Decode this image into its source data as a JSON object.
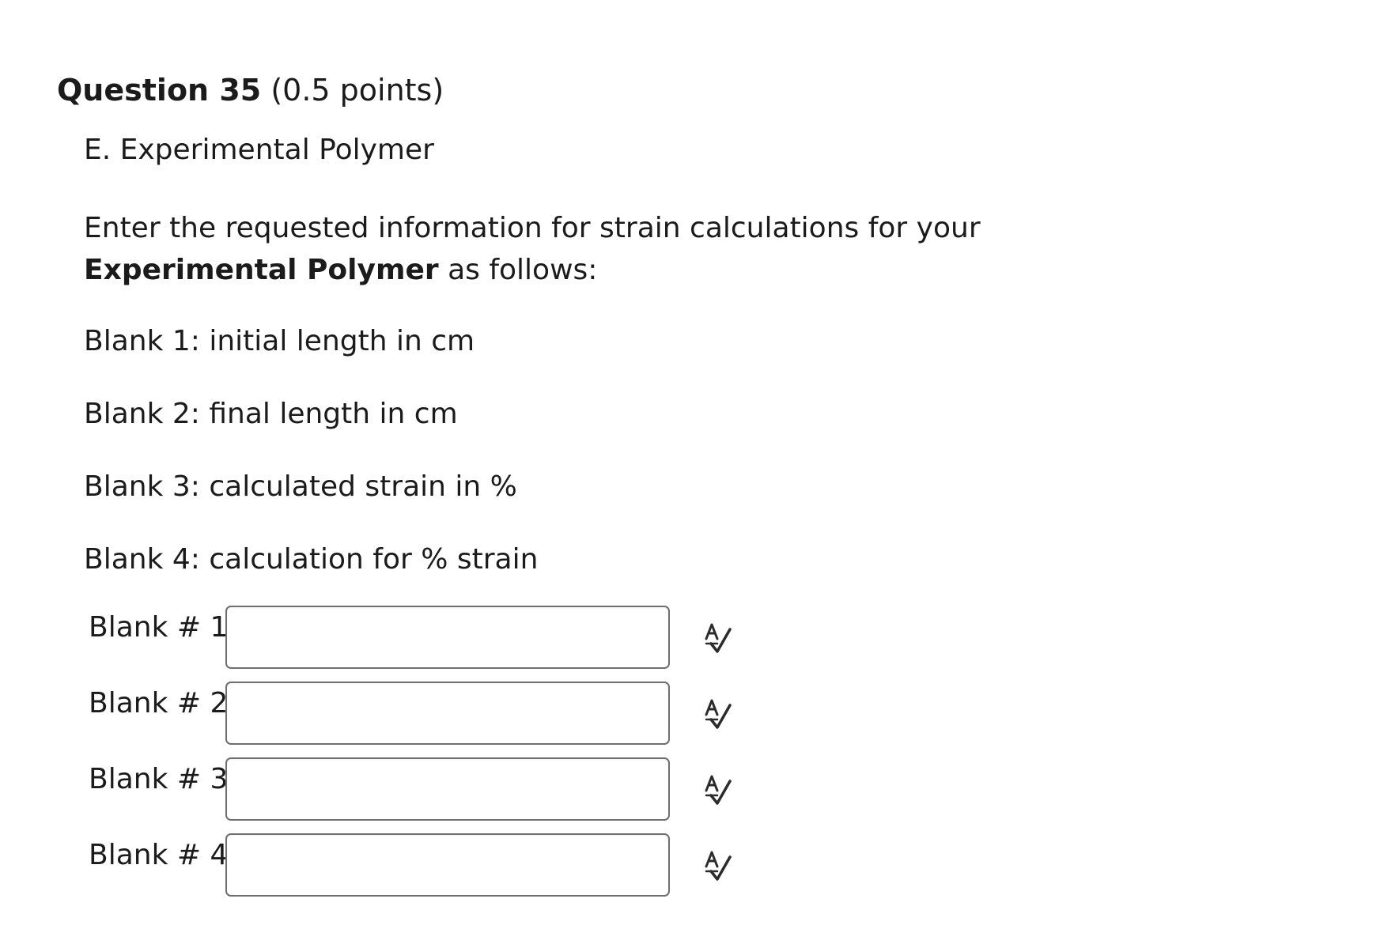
{
  "question": {
    "title": "Question 35",
    "points": "(0.5 points)"
  },
  "section_title": "E. Experimental Polymer",
  "instructions": {
    "prefix": "Enter the requested information for strain calculations for your ",
    "bold": "Experimental Polymer",
    "suffix": " as follows:"
  },
  "blank_descriptions": [
    "Blank 1: initial length in cm",
    "Blank 2: final length in cm",
    "Blank 3: calculated strain in %",
    "Blank 4: calculation for % strain"
  ],
  "blanks": [
    {
      "label": "Blank # 1",
      "value": "",
      "icon": "spell-check-icon"
    },
    {
      "label": "Blank # 2",
      "value": "",
      "icon": "spell-check-icon"
    },
    {
      "label": "Blank # 3",
      "value": "",
      "icon": "spell-check-icon"
    },
    {
      "label": "Blank # 4",
      "value": "",
      "icon": "spell-check-icon"
    }
  ]
}
